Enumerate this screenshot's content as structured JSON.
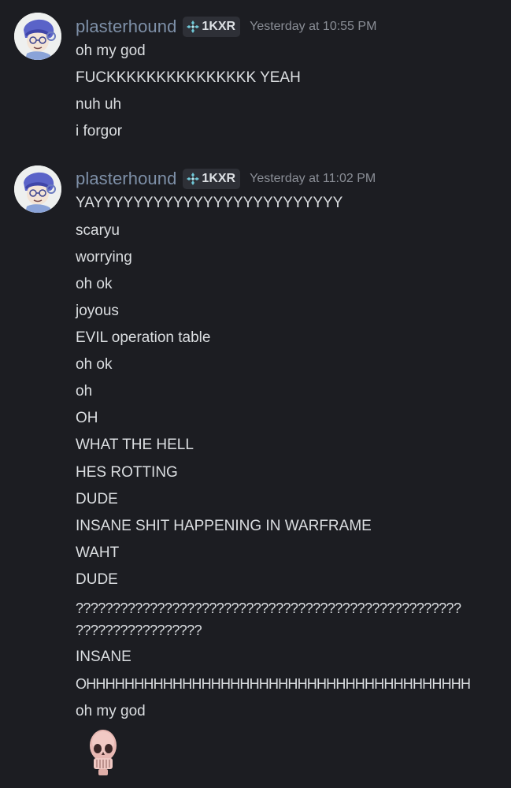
{
  "groups": [
    {
      "username": "plasterhound",
      "tag": "1KXR",
      "timestamp": "Yesterday at 10:55 PM",
      "messages": [
        "oh my god",
        "FUCKKKKKKKKKKKKKKK YEAH",
        "nuh uh",
        "i forgor"
      ]
    },
    {
      "username": "plasterhound",
      "tag": "1KXR",
      "timestamp": "Yesterday at 11:02 PM",
      "messages": [
        "YAYYYYYYYYYYYYYYYYYYYYYYYYY",
        "scaryu",
        "worrying",
        "oh ok",
        "joyous",
        "EVIL operation table",
        "oh ok",
        "oh",
        "OH",
        "WHAT THE HELL",
        "HES ROTTING",
        "DUDE",
        "INSANE SHIT HAPPENING IN WARFRAME",
        "WAHT",
        "DUDE",
        "????????????????????????????????????????????????????",
        "?????????????????",
        "INSANE",
        "OHHHHHHHHHHHHHHHHHHHHHHHHHHHHHHHHHHHHHHHH",
        "oh my god"
      ]
    }
  ],
  "icons": {
    "tag_icon": "diamond-cluster-icon",
    "sticker": "skull-emoji"
  },
  "colors": {
    "background": "#1c1d22",
    "username": "#7e90a8",
    "text": "#dbdee1",
    "timestamp": "#8a8e96",
    "tag_bg": "#2e3037",
    "tag_icon": "#6fc7d6"
  }
}
